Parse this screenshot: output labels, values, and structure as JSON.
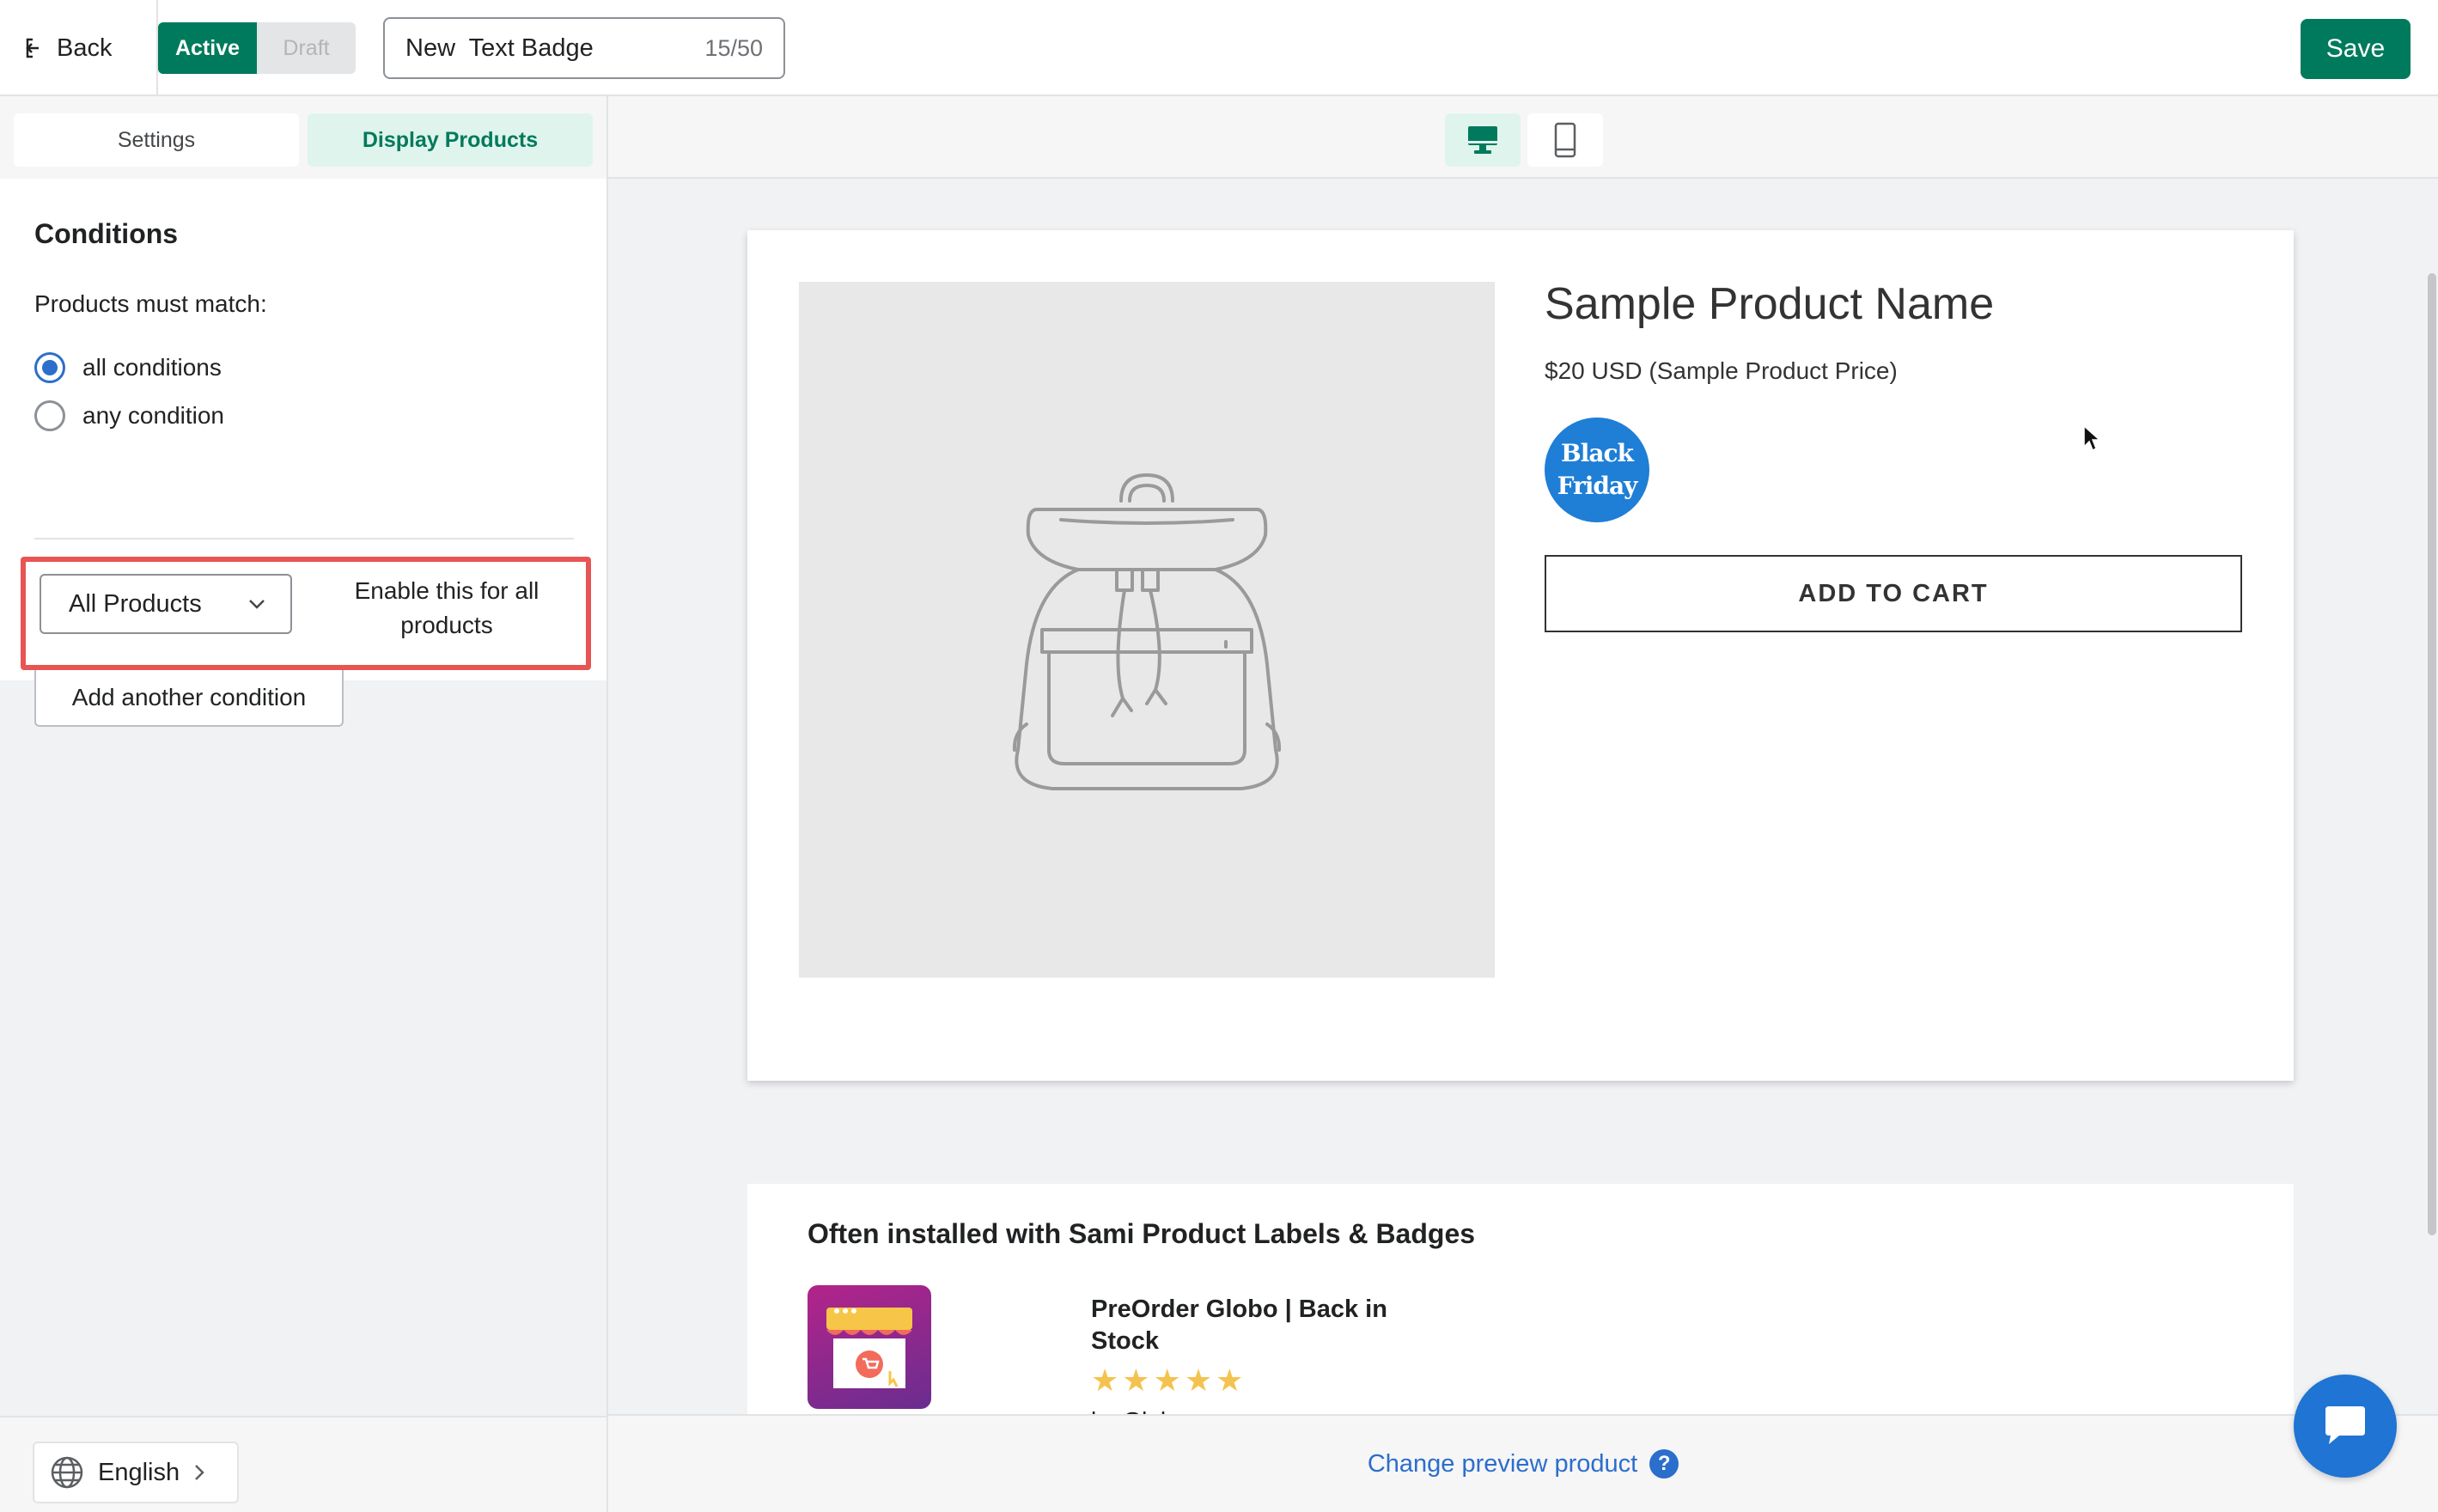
{
  "topbar": {
    "back_label": "Back",
    "status_active": "Active",
    "status_draft": "Draft",
    "badge_name": "New  Text Badge",
    "char_counter": "15/50",
    "save_label": "Save"
  },
  "sidebar": {
    "tabs": [
      {
        "label": "Settings",
        "selected": false
      },
      {
        "label": "Display Products",
        "selected": true
      }
    ],
    "conditions": {
      "title": "Conditions",
      "match_label": "Products must match:",
      "options": [
        {
          "label": "all conditions",
          "checked": true
        },
        {
          "label": "any condition",
          "checked": false
        }
      ],
      "rule_select": "All Products",
      "rule_description": "Enable this for all products",
      "add_button": "Add another condition"
    },
    "language": "English"
  },
  "preview": {
    "devices": [
      "desktop-icon",
      "mobile-icon"
    ],
    "active_device": "desktop",
    "product": {
      "title": "Sample Product Name",
      "price": "$20 USD (Sample Product Price)",
      "badge_text": "Black Friday",
      "badge_color": "#1f7ed6",
      "cart_button": "ADD TO CART"
    },
    "often": {
      "title": "Often installed with Sami Product Labels & Badges",
      "app_name": "PreOrder Globo | Back in Stock",
      "rating": 5,
      "by": "by Globo"
    },
    "change_link": "Change preview product",
    "help": "?"
  },
  "colors": {
    "primary_green": "#007a5c",
    "highlight_red": "#e85454",
    "link_blue": "#2c6ecb"
  }
}
